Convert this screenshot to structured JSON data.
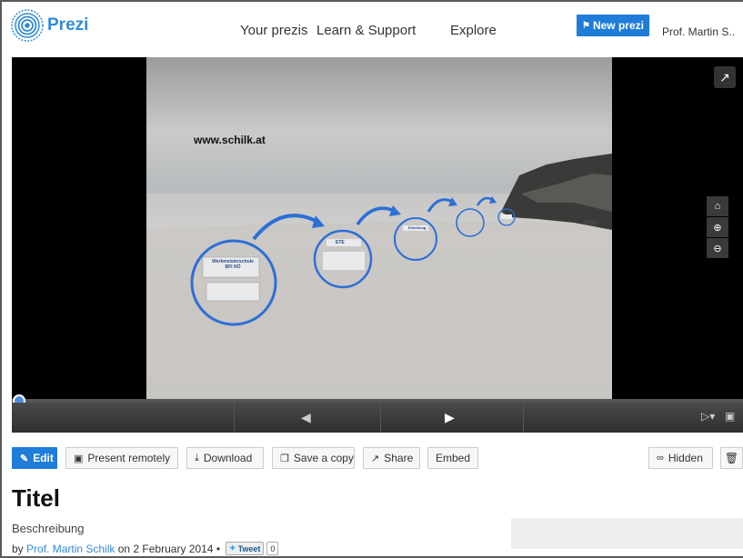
{
  "header": {
    "logo_text": "Prezi",
    "nav": [
      "Your prezis",
      "Learn & Support",
      "Explore"
    ],
    "new_prezi_label": "New prezi",
    "user_name": "Prof. Martin S.."
  },
  "viewer": {
    "slide_title": "www.schilk.at",
    "node_labels": [
      "Werkmeisterschule BFI NÖ",
      "ETE",
      "Einleitung"
    ],
    "progress": 0
  },
  "toolbar": {
    "edit": "Edit",
    "present_remotely": "Present remotely",
    "download": "Download",
    "save_copy": "Save a copy",
    "share": "Share",
    "embed": "Embed",
    "hidden": "Hidden"
  },
  "prezi": {
    "title": "Titel",
    "description": "Beschreibung",
    "by_prefix": "by",
    "author": "Prof. Martin Schilk",
    "date_text": "on 2 February 2014",
    "separator": "•",
    "tweet_label": "Tweet",
    "tweet_count": "0"
  },
  "colors": {
    "brand": "#318bd7",
    "primary_button": "#1f7cd9",
    "viewer_bg": "#000000"
  },
  "icons": {
    "logo": "prezi-logo-icon",
    "new_prezi": "new-prezi-icon",
    "share_viewer": "share-icon",
    "home": "home-icon",
    "zoom_in": "zoom-in-icon",
    "zoom_out": "zoom-out-icon",
    "prev": "arrow-left-icon",
    "next": "arrow-right-icon",
    "fullscreen": "fullscreen-icon",
    "autoplay": "autoplay-icon",
    "edit": "pencil-icon",
    "present_remotely": "presentation-icon",
    "download": "download-icon",
    "save_copy": "copy-icon",
    "share": "share-icon",
    "hidden": "link-icon",
    "delete": "trash-icon"
  }
}
